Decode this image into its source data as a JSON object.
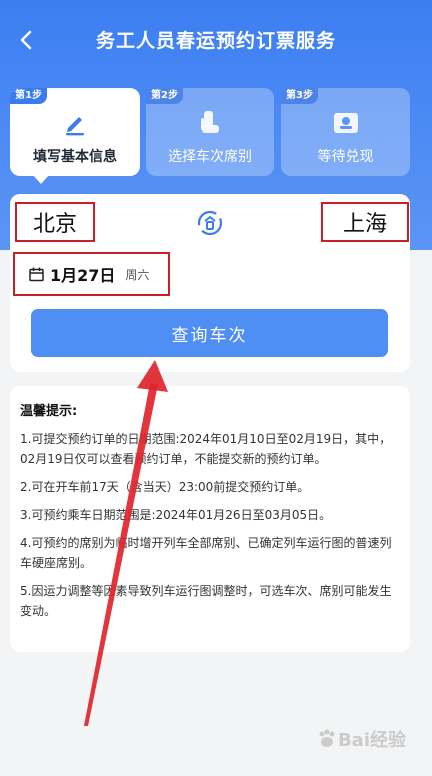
{
  "header": {
    "title": "务工人员春运预约订票服务"
  },
  "steps": [
    {
      "tag": "第1步",
      "label": "填写基本信息",
      "active": true
    },
    {
      "tag": "第2步",
      "label": "选择车次席别",
      "active": false
    },
    {
      "tag": "第3步",
      "label": "等待兑现",
      "active": false
    }
  ],
  "search": {
    "from_city": "北京",
    "to_city": "上海",
    "date": "1月27日",
    "weekday": "周六",
    "query_button": "查询车次"
  },
  "tips": {
    "title": "温馨提示:",
    "items": [
      "1.可提交预约订单的日期范围:2024年01月10日至02月19日，其中，02月19日仅可以查看预约订单，不能提交新的预约订单。",
      "2.可在开车前17天（含当天）23:00前提交预约订单。",
      "3.可预约乘车日期范围是:2024年01月26日至03月05日。",
      "4.可预约的席别为临时增开列车全部席别、已确定列车运行图的普速列车硬座席别。",
      "5.因运力调整等因素导致列车运行图调整时，可选车次、席别可能发生变动。"
    ]
  },
  "watermark": {
    "text": "Bai经验"
  },
  "colors": {
    "primary": "#3c7ef2",
    "button": "#4f8ef2",
    "highlight_box": "#c8202a",
    "arrow": "#e0242c"
  },
  "icons": {
    "back": "back-chevron-icon",
    "step1": "pen-icon",
    "step2": "seat-icon",
    "step3": "ticket-icon",
    "swap": "swap-icon",
    "date": "calendar-icon"
  }
}
